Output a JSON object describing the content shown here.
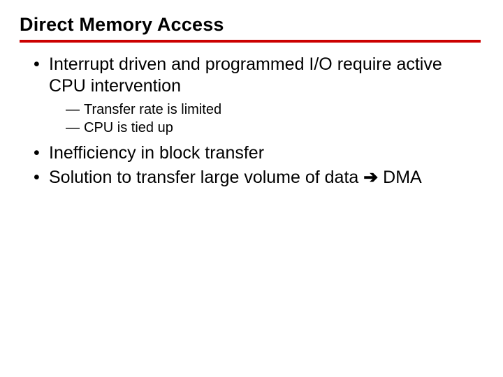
{
  "title": "Direct Memory Access",
  "bullets": {
    "b0": {
      "text": "Interrupt driven and programmed I/O require active CPU intervention",
      "sub": {
        "s0": "Transfer rate is limited",
        "s1": "CPU is tied up"
      }
    },
    "b1": {
      "text": "Inefficiency in block transfer"
    },
    "b2": {
      "prefix": "Solution to transfer large volume of data ",
      "arrow": "➔",
      "suffix": " DMA"
    }
  },
  "colors": {
    "accent": "#cc0000",
    "text": "#000000",
    "background": "#ffffff"
  }
}
